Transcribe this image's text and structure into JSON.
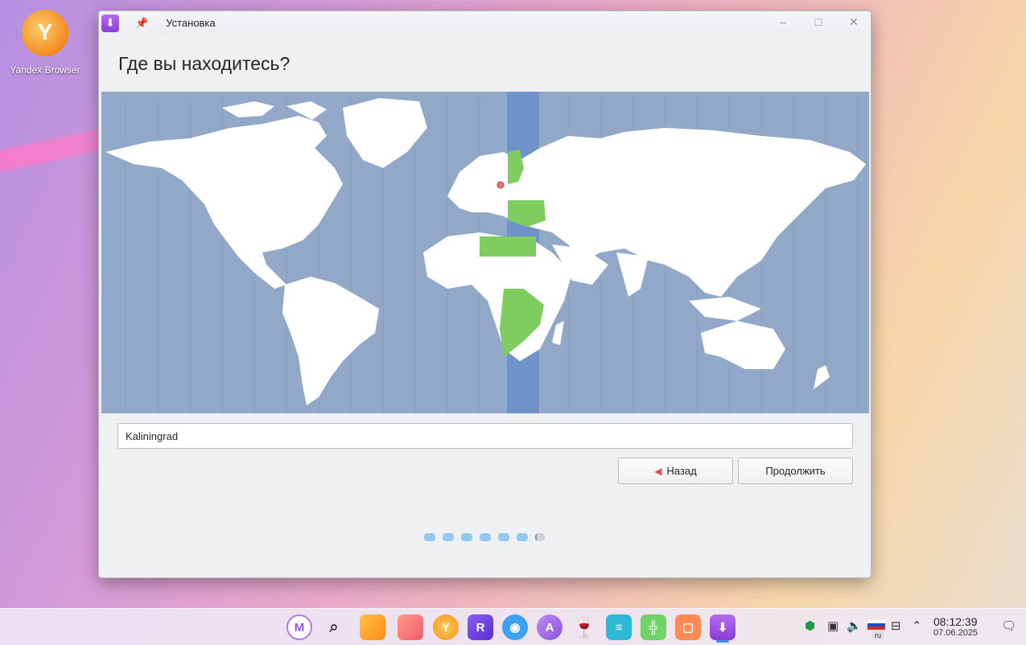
{
  "desktop": {
    "icon_label": "Yandex Browser"
  },
  "window": {
    "title": "Установка",
    "heading": "Где вы находитесь?",
    "controls": {
      "minimize": "‒",
      "maximize": "□",
      "close": "✕"
    }
  },
  "timezone": {
    "value": "Kaliningrad"
  },
  "buttons": {
    "back": "Назад",
    "continue": "Продолжить"
  },
  "progress": {
    "total_steps": 7,
    "current_step": 7
  },
  "taskbar": {
    "apps": [
      "menu",
      "search",
      "files",
      "notes",
      "yandex-browser",
      "rustore",
      "maps",
      "translator",
      "wine",
      "editor",
      "spreadsheet",
      "presentation",
      "installer"
    ],
    "time": "08:12:39",
    "date": "07.06.2025",
    "keyboard_layout": "ru"
  },
  "colors": {
    "map_ocean": "#92a8c8",
    "map_land": "#ffffff",
    "timezone_highlight": "#7fcd5e",
    "timezone_band": "#6f93c9",
    "progress_dot": "#93c9ec"
  }
}
